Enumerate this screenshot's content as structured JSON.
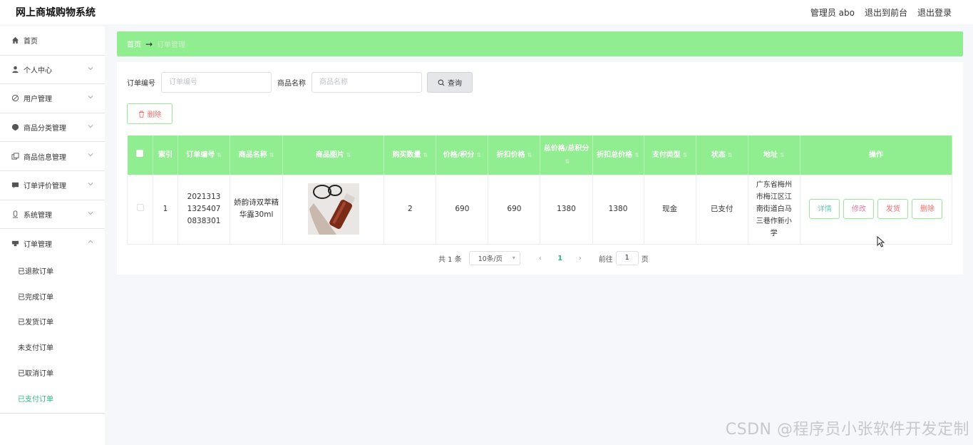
{
  "header": {
    "brand": "网上商城购物系统",
    "user": "管理员 abo",
    "to_front": "退出到前台",
    "logout": "退出登录"
  },
  "sidebar": {
    "items": [
      {
        "label": "首页",
        "icon": "home-icon"
      },
      {
        "label": "个人中心",
        "icon": "person-icon"
      },
      {
        "label": "用户管理",
        "icon": "user-manage-icon"
      },
      {
        "label": "商品分类管理",
        "icon": "category-icon"
      },
      {
        "label": "商品信息管理",
        "icon": "product-info-icon"
      },
      {
        "label": "订单评价管理",
        "icon": "comment-icon"
      },
      {
        "label": "系统管理",
        "icon": "system-icon"
      },
      {
        "label": "订单管理",
        "icon": "order-icon"
      }
    ],
    "sub_items": [
      "已退款订单",
      "已完成订单",
      "已发货订单",
      "未支付订单",
      "已取消订单",
      "已支付订单"
    ],
    "active_sub": "已支付订单"
  },
  "breadcrumb": {
    "home": "首页",
    "arrow": "→",
    "current": "订单管理"
  },
  "search": {
    "order_no_label": "订单编号",
    "order_no_placeholder": "订单编号",
    "product_name_label": "商品名称",
    "product_name_placeholder": "商品名称",
    "query_button": "查询"
  },
  "delete_button": "删除",
  "table": {
    "headers": [
      "索引",
      "订单编号",
      "商品名称",
      "商品图片",
      "购买数量",
      "价格/积分",
      "折扣价格",
      "总价格/总积分",
      "折扣总价格",
      "支付类型",
      "状态",
      "地址",
      "操作"
    ],
    "rows": [
      {
        "index": "1",
        "order_no": "202131313254070838301",
        "product_name": "娇韵诗双萃精华露30ml",
        "quantity": "2",
        "price": "690",
        "discount_price": "690",
        "total": "1380",
        "discount_total": "1380",
        "pay_type": "现金",
        "status": "已支付",
        "address": "广东省梅州市梅江区江南街道白马三巷作新小学",
        "actions": {
          "detail": "详情",
          "edit": "修改",
          "ship": "发货",
          "remove": "删除"
        }
      }
    ]
  },
  "pagination": {
    "total": "共 1 条",
    "page_size": "10条/页",
    "current_page": "1",
    "goto_label": "前往",
    "goto_value": "1",
    "page_unit": "页"
  },
  "watermark": "CSDN @程序员小张软件开发定制",
  "colors": {
    "accent": "#90ee90",
    "active_text": "#2fb48c",
    "danger": "#f56c6c"
  }
}
